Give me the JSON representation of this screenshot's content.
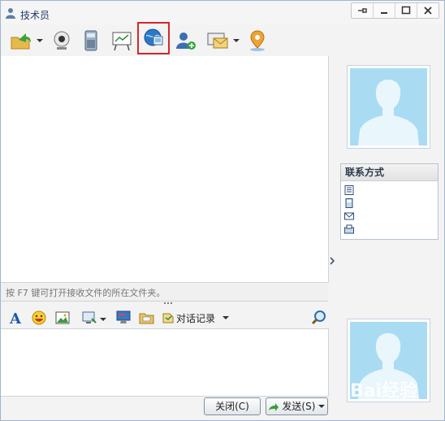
{
  "window": {
    "title": "技术员"
  },
  "toolbar": {
    "items": [
      {
        "name": "send-file-icon"
      },
      {
        "name": "video-icon"
      },
      {
        "name": "phone-icon"
      },
      {
        "name": "whiteboard-icon"
      },
      {
        "name": "remote-assist-icon"
      },
      {
        "name": "add-contact-icon"
      },
      {
        "name": "mail-icon"
      },
      {
        "name": "location-icon"
      }
    ]
  },
  "chat": {
    "hint": "按 F7 键可打开接收文件的所在文件夹。"
  },
  "format_bar": {
    "history_label": "对话记录"
  },
  "buttons": {
    "close_label": "关闭(C)",
    "send_label": "发送(S)"
  },
  "contact": {
    "header": "联系方式"
  },
  "watermark": "Bai经验"
}
